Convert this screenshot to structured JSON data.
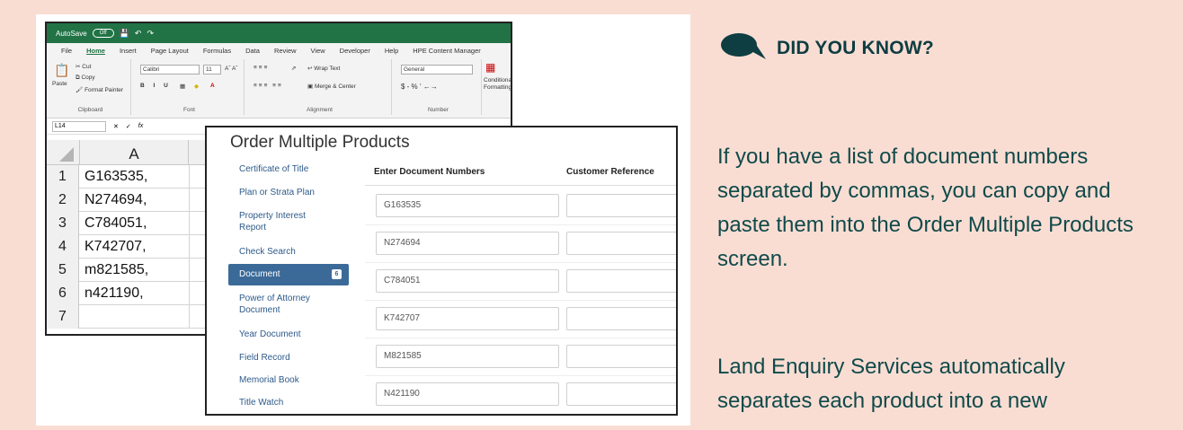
{
  "excel": {
    "autosave_label": "AutoSave",
    "autosave_state": "Off",
    "tabs": [
      "File",
      "Home",
      "Insert",
      "Page Layout",
      "Formulas",
      "Data",
      "Review",
      "View",
      "Developer",
      "Help",
      "HPE Content Manager"
    ],
    "active_tab": "Home",
    "clipboard": {
      "paste": "Paste",
      "cut": "Cut",
      "copy": "Copy",
      "format_painter": "Format Painter",
      "label": "Clipboard"
    },
    "font": {
      "name": "Calibri",
      "size": "11",
      "label": "Font"
    },
    "alignment": {
      "wrap_text": "Wrap Text",
      "merge_center": "Merge & Center",
      "label": "Alignment"
    },
    "number": {
      "format": "General",
      "label": "Number"
    },
    "conditional": "Conditional Formatting",
    "name_box": "L14",
    "fx": "fx",
    "column_header": "A",
    "rows": [
      {
        "num": "1",
        "value": "G163535,"
      },
      {
        "num": "2",
        "value": "N274694,"
      },
      {
        "num": "3",
        "value": "C784051,"
      },
      {
        "num": "4",
        "value": "K742707,"
      },
      {
        "num": "5",
        "value": "m821585,"
      },
      {
        "num": "6",
        "value": "n421190,"
      },
      {
        "num": "7",
        "value": ""
      }
    ]
  },
  "omp": {
    "title": "Order Multiple Products",
    "nav": [
      {
        "label": "Certificate of Title"
      },
      {
        "label": "Plan or Strata Plan"
      },
      {
        "label": "Property Interest Report"
      },
      {
        "label": "Check Search"
      },
      {
        "label": "Document",
        "badge": "6",
        "active": true
      },
      {
        "label": "Power of Attorney Document"
      },
      {
        "label": "Year Document"
      },
      {
        "label": "Field Record"
      },
      {
        "label": "Memorial Book"
      },
      {
        "label": "Title Watch"
      }
    ],
    "col_document_numbers": "Enter Document Numbers",
    "col_customer_reference": "Customer Reference",
    "document_values": [
      "G163535",
      "N274694",
      "C784051",
      "K742707",
      "M821585",
      "N421190"
    ]
  },
  "callout": {
    "title": "DID YOU KNOW?",
    "icon": "speech-bubble-icon",
    "paragraph1": "If you have a list of document numbers separated by commas, you can copy and paste them into the Order Multiple Products screen.",
    "paragraph2": "Land Enquiry Services automatically separates each product into a new"
  },
  "colors": {
    "background": "#f9ddd3",
    "excel_green": "#217346",
    "accent_blue": "#3b6a99",
    "text_teal": "#104a4a"
  }
}
